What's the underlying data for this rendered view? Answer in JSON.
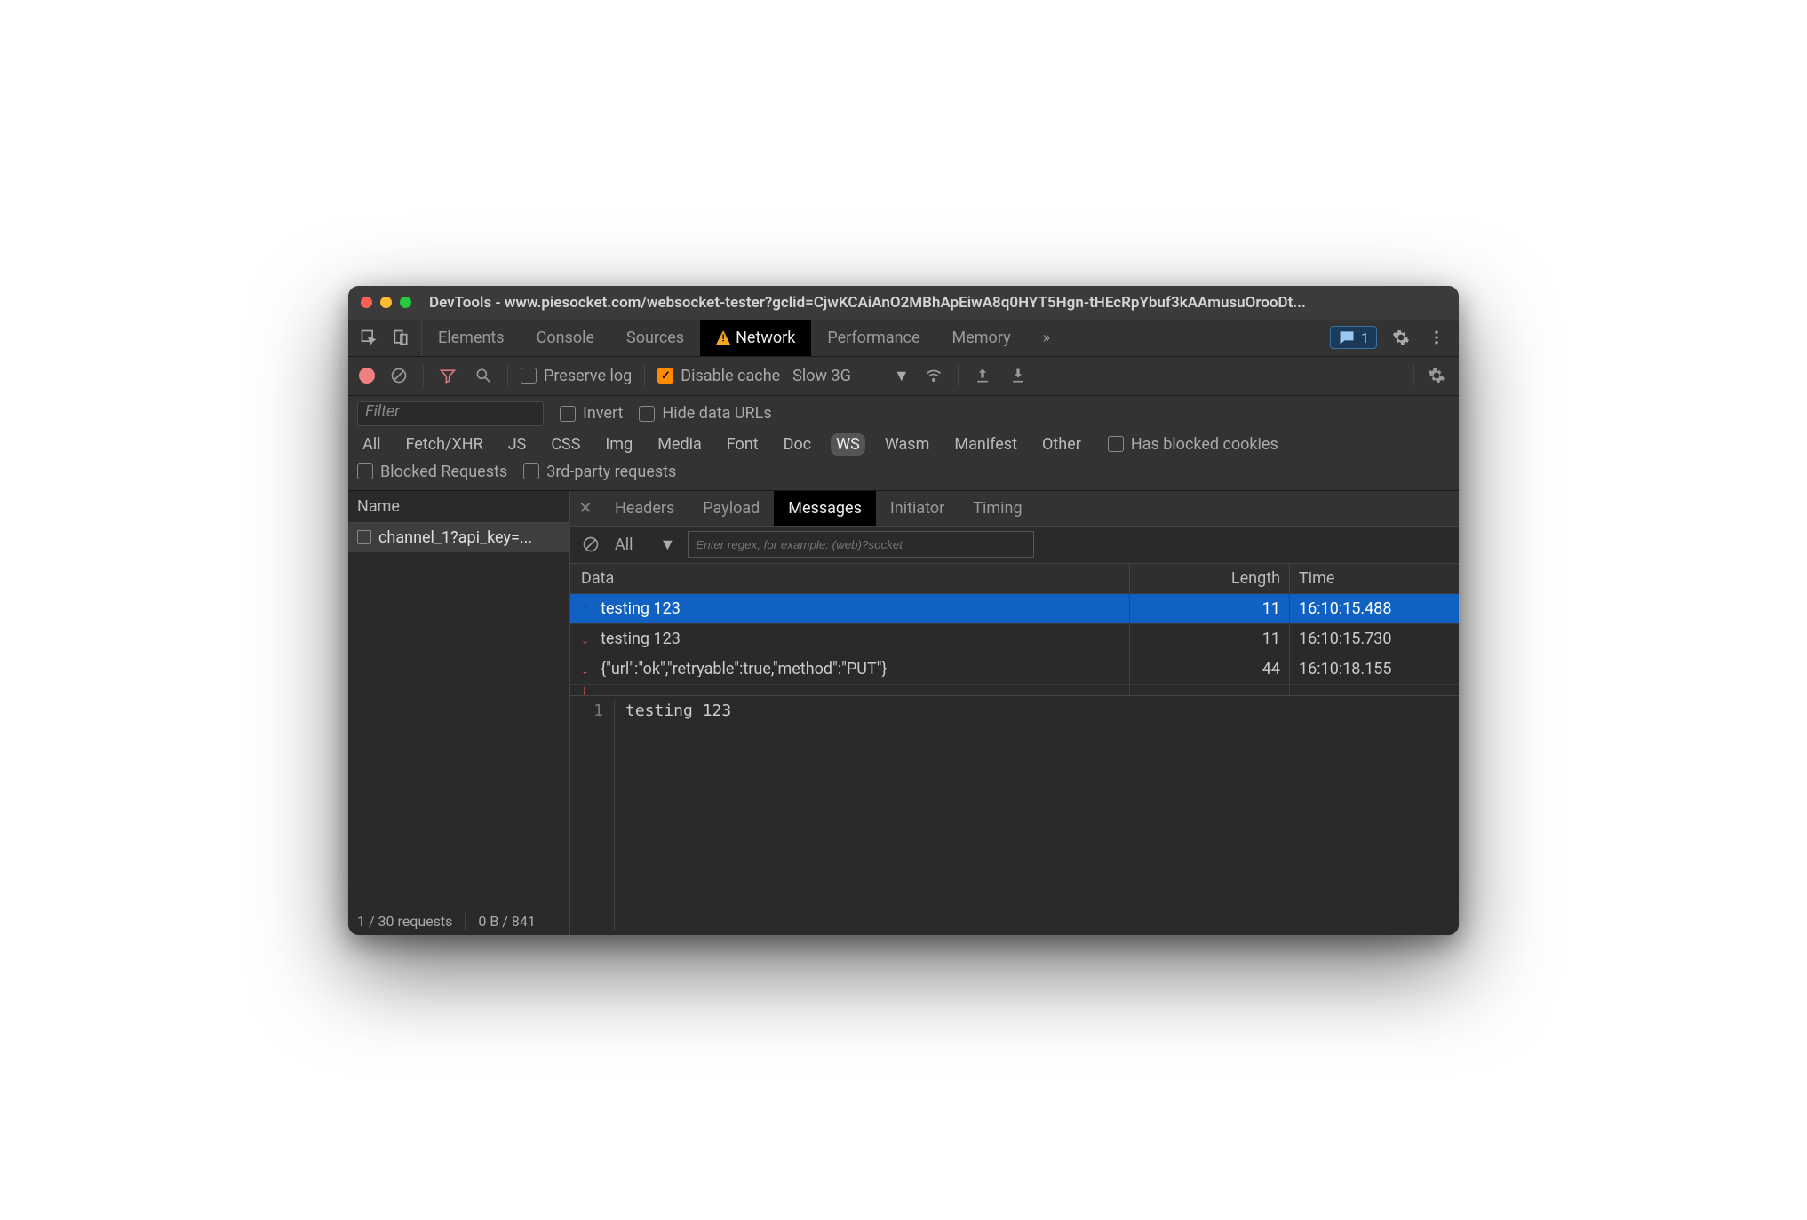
{
  "window": {
    "title": "DevTools - www.piesocket.com/websocket-tester?gclid=CjwKCAiAnO2MBhApEiwA8q0HYT5Hgn-tHEcRpYbuf3kAAmusuOrooDt..."
  },
  "main_tabs": {
    "items": [
      "Elements",
      "Console",
      "Sources",
      "Network",
      "Performance",
      "Memory"
    ],
    "active": "Network",
    "badge_count": "1"
  },
  "toolbar": {
    "preserve_log": "Preserve log",
    "disable_cache": "Disable cache",
    "throttling": "Slow 3G"
  },
  "filter": {
    "placeholder": "Filter",
    "invert": "Invert",
    "hide_data_urls": "Hide data URLs",
    "types": [
      "All",
      "Fetch/XHR",
      "JS",
      "CSS",
      "Img",
      "Media",
      "Font",
      "Doc",
      "WS",
      "Wasm",
      "Manifest",
      "Other"
    ],
    "selected_type": "WS",
    "has_blocked_cookies": "Has blocked cookies",
    "blocked_requests": "Blocked Requests",
    "third_party": "3rd-party requests"
  },
  "requests": {
    "name_header": "Name",
    "items": [
      {
        "label": "channel_1?api_key=..."
      }
    ],
    "status_left": "1 / 30 requests",
    "status_right": "0 B / 841"
  },
  "detail_tabs": [
    "Headers",
    "Payload",
    "Messages",
    "Initiator",
    "Timing"
  ],
  "detail_active": "Messages",
  "messages_bar": {
    "filter_label": "All",
    "regex_placeholder": "Enter regex, for example: (web)?socket"
  },
  "message_headers": {
    "data": "Data",
    "length": "Length",
    "time": "Time"
  },
  "messages": [
    {
      "dir": "up",
      "data": "testing 123",
      "length": "11",
      "time": "16:10:15.488",
      "selected": true
    },
    {
      "dir": "down",
      "data": "testing 123",
      "length": "11",
      "time": "16:10:15.730",
      "selected": false
    },
    {
      "dir": "down",
      "data": "{\"url\":\"ok\",\"retryable\":true,\"method\":\"PUT\"}",
      "length": "44",
      "time": "16:10:18.155",
      "selected": false
    }
  ],
  "preview": {
    "lineno": "1",
    "text": "testing 123"
  }
}
